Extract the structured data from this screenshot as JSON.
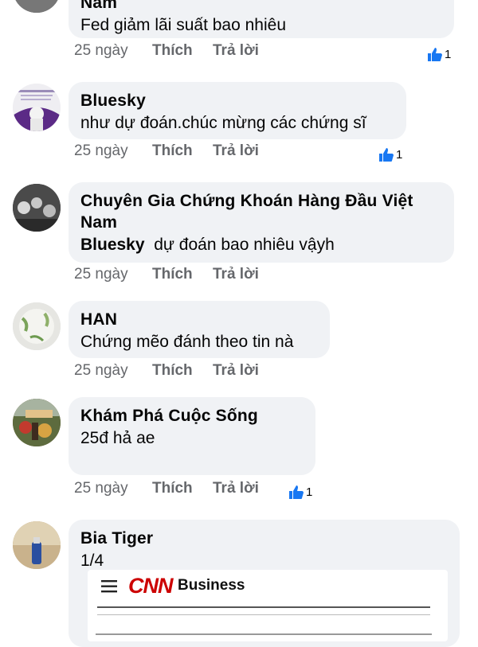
{
  "meta_labels": {
    "time": "25 ngày",
    "like": "Thích",
    "reply": "Trả lời"
  },
  "comments": [
    {
      "name": "Nam",
      "text": "Fed giảm lãi suất bao nhiêu",
      "reactions": "1"
    },
    {
      "name": "Bluesky",
      "text": "như dự đoán.chúc mừng các chứng sĩ",
      "reactions": "1"
    },
    {
      "name_line1": "Chuyên Gia Chứng Khoán Hàng Đầu Việt",
      "name_line2": "Nam",
      "mention": "Bluesky",
      "text": "dự đoán bao nhiêu vậyh"
    },
    {
      "name": "HAN",
      "text": "Chứng mẽo đánh theo tin nà"
    },
    {
      "name": "Khám Phá Cuộc Sống",
      "text": "25đ hả ae",
      "reactions": "1"
    },
    {
      "name": "Bia Tiger",
      "text": "1/4"
    }
  ],
  "cnn_header": {
    "logo": "CNN",
    "section": "Business"
  },
  "colors": {
    "bubble": "#f0f2f5",
    "meta": "#65676b",
    "like_blue": "#1877f2",
    "cnn_red": "#cc0000"
  }
}
